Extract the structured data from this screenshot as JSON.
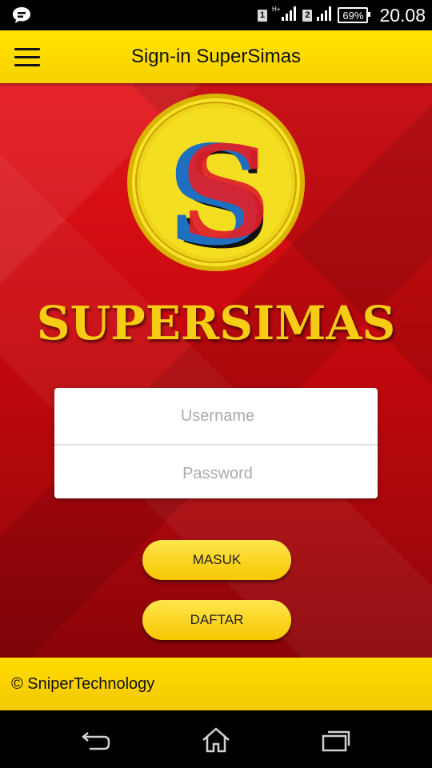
{
  "status_bar": {
    "sim1": "1",
    "network": "H+",
    "sim2": "2",
    "battery": "69%",
    "time": "20.08"
  },
  "app_bar": {
    "title": "Sign-in SuperSimas",
    "menu_icon": "hamburger-menu-icon"
  },
  "logo": {
    "letter": "S",
    "icon": "supersimas-logo"
  },
  "brand": {
    "name": "SUPERSIMAS"
  },
  "login_form": {
    "username_placeholder": "Username",
    "password_placeholder": "Password"
  },
  "buttons": {
    "masuk": "MASUK",
    "daftar": "DAFTAR"
  },
  "footer": {
    "copyright": "© SniperTechnology"
  },
  "nav_bar": {
    "back_icon": "back-icon",
    "home_icon": "home-icon",
    "recents_icon": "recents-icon"
  },
  "colors": {
    "accent_yellow": "#FFE000",
    "background_red": "#C9090E",
    "logo_blue": "#1e6fc0"
  }
}
